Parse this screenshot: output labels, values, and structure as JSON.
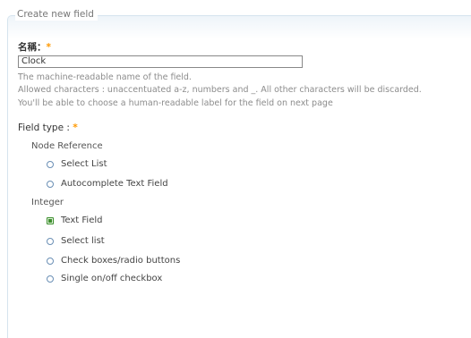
{
  "fieldset": {
    "legend": "Create new field"
  },
  "name_field": {
    "label": "名稱：",
    "required_marker": "*",
    "value": "Clock"
  },
  "description": {
    "line1": "The machine-readable name of the field.",
    "line2": "Allowed characters : unaccentuated a-z, numbers and _. All other characters will be discarded.",
    "line3": "You'll be able to choose a human-readable label for the field on next page"
  },
  "field_type": {
    "label": "Field type :",
    "required_marker": "*",
    "groups": [
      {
        "label": "Node Reference",
        "options": [
          {
            "label": "Select List",
            "selected": false
          },
          {
            "label": "Autocomplete Text Field",
            "selected": false
          }
        ]
      },
      {
        "label": "Integer",
        "options": [
          {
            "label": "Text Field",
            "selected": true
          },
          {
            "label": "Select list",
            "selected": false
          },
          {
            "label": "Check boxes/radio buttons",
            "selected": false
          },
          {
            "label": "Single on/off checkbox",
            "selected": false
          }
        ]
      }
    ]
  },
  "colors": {
    "required": "#ff9900",
    "selected_radio": "#3d8f2e",
    "radio_border": "#6a8fb5"
  }
}
